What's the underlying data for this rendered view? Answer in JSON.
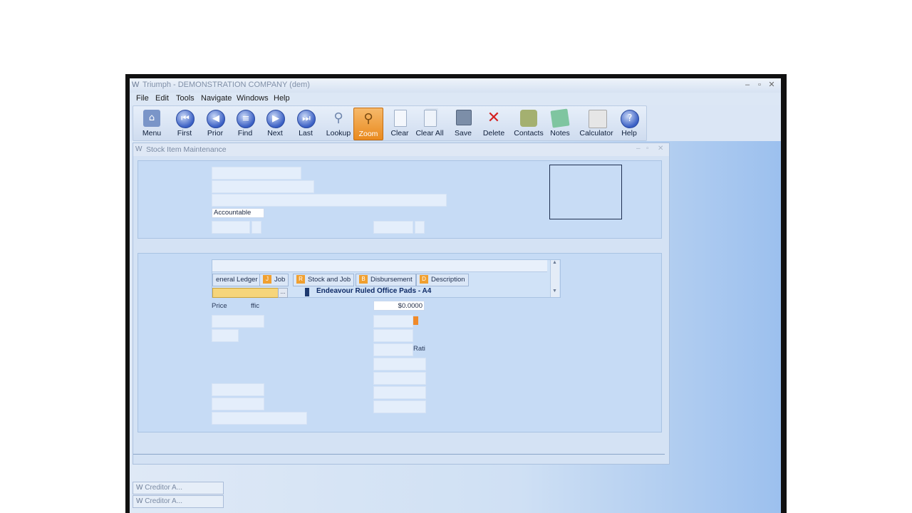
{
  "window": {
    "title": "Triumph - DEMONSTRATION COMPANY (dem)",
    "controls": [
      "–",
      "▫",
      "✕"
    ]
  },
  "menu": [
    "File",
    "Edit",
    "Tools",
    "Navigate",
    "Windows",
    "Help"
  ],
  "toolbar": [
    {
      "label": "Menu",
      "icon": "home-icon"
    },
    {
      "label": "First",
      "icon": "first-icon"
    },
    {
      "label": "Prior",
      "icon": "prior-icon"
    },
    {
      "label": "Find",
      "icon": "find-icon"
    },
    {
      "label": "Next",
      "icon": "next-icon"
    },
    {
      "label": "Last",
      "icon": "last-icon"
    },
    {
      "label": "Lookup",
      "icon": "lookup-icon"
    },
    {
      "label": "Zoom",
      "icon": "zoom-icon"
    },
    {
      "label": "Clear",
      "icon": "clear-icon"
    },
    {
      "label": "Clear All",
      "icon": "clear-all-icon"
    },
    {
      "label": "Save",
      "icon": "save-icon"
    },
    {
      "label": "Delete",
      "icon": "delete-icon"
    },
    {
      "label": "Contacts",
      "icon": "contacts-icon"
    },
    {
      "label": "Notes",
      "icon": "notes-icon"
    },
    {
      "label": "Calculator",
      "icon": "calculator-icon"
    },
    {
      "label": "Help",
      "icon": "help-icon"
    }
  ],
  "child": {
    "title": "Stock Item Maintenance",
    "accountable": "Accountable",
    "tabs": [
      {
        "key": "",
        "label": "eneral Ledger"
      },
      {
        "key": "J",
        "label": "Job"
      },
      {
        "key": "R",
        "label": "Stock and Job"
      },
      {
        "key": "B",
        "label": "Disbursement"
      },
      {
        "key": "D",
        "label": "Description"
      }
    ],
    "lookup_button": "...",
    "item_description": "Endeavour Ruled Office Pads - A4",
    "price_label": "Price",
    "price_label2": "ffic",
    "price_value": "$0.0000",
    "rate_label": "Rati"
  },
  "taskbar": [
    {
      "title": "Creditor A..."
    },
    {
      "title": "Creditor A..."
    }
  ],
  "colors": {
    "accent": "#e98a1f",
    "panel": "#c6dbf5",
    "title_text": "#8090a8"
  }
}
